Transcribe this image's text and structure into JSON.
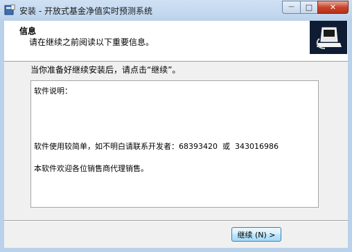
{
  "window": {
    "title": "安装 - 开放式基金净值实时预测系统",
    "caption_buttons": {
      "minimize": "—",
      "maximize": "□",
      "close": "✕"
    }
  },
  "header": {
    "title": "信息",
    "subtitle": "请在继续之前阅读以下重要信息。"
  },
  "main": {
    "intro": "当你准备好继续安装后，请点击“继续”。",
    "memo_lines": [
      "软件说明：",
      "软件使用较简单，如不明白请联系开发者：68393420  或  343016986",
      "本软件欢迎各位销售商代理销售。"
    ]
  },
  "footer": {
    "next_button": "继续 (N) >"
  },
  "colors": {
    "titlebar": "#c2d7ee",
    "client": "#f0f0f0",
    "logo_bg": "#0f1c33",
    "close_button": "#c8452c"
  },
  "icons": [
    "setup-app-icon",
    "installer-logo-icon"
  ]
}
